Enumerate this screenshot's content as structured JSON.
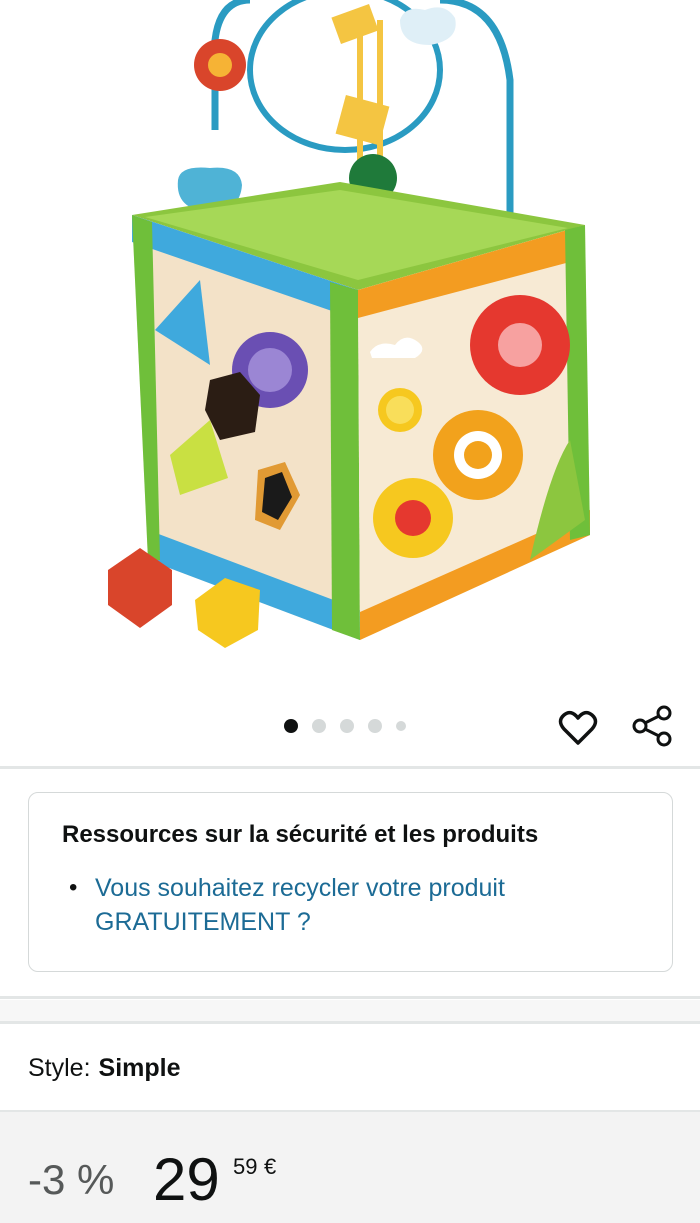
{
  "gallery": {
    "image_alt": "Wooden activity cube toy with bead maze",
    "dots_total": 5,
    "active_dot": 1,
    "icons": {
      "wishlist": "heart-icon",
      "share": "share-icon"
    }
  },
  "safety": {
    "title": "Ressources sur la sécurité et les produits",
    "link_line1": "Vous souhaitez recycler votre produit",
    "link_line2": "GRATUITEMENT ?"
  },
  "style": {
    "label": "Style:",
    "value": "Simple"
  },
  "price": {
    "discount": "-3 %",
    "whole": "29",
    "fraction": "59",
    "currency": "€"
  },
  "colors": {
    "link": "#1c6b95",
    "divider": "#e3e6e6",
    "price_bar": "#f3f3f3"
  }
}
